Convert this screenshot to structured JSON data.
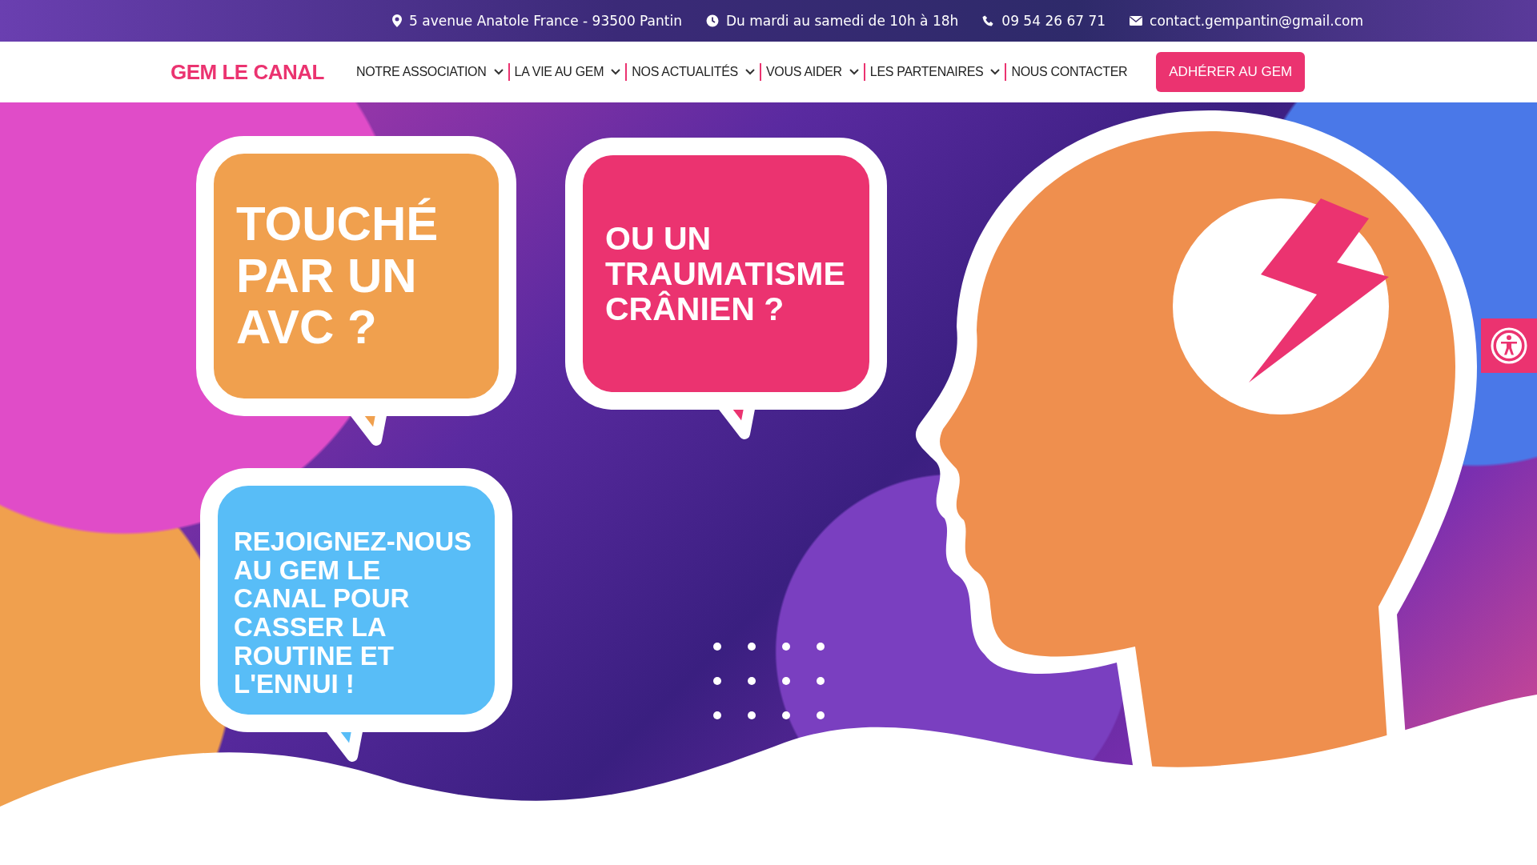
{
  "top_bar": {
    "items": [
      {
        "kind": "address",
        "text": "5 avenue Anatole France - 93500 Pantin"
      },
      {
        "kind": "hours",
        "text": "Du mardi au samedi de 10h à 18h"
      },
      {
        "kind": "phone",
        "text": "09 54 26 67 71"
      },
      {
        "kind": "email",
        "text": "contact.gempantin@gmail.com"
      }
    ]
  },
  "nav": {
    "logo": "GEM LE CANAL",
    "items": [
      {
        "label": "NOTRE ASSOCIATION",
        "dropdown": true
      },
      {
        "label": "LA VIE AU GEM",
        "dropdown": true
      },
      {
        "label": "NOS ACTUALITÉS",
        "dropdown": true
      },
      {
        "label": "VOUS AIDER",
        "dropdown": true
      },
      {
        "label": "LES PARTENAIRES",
        "dropdown": true
      },
      {
        "label": "NOUS CONTACTER",
        "dropdown": false
      }
    ],
    "cta": "ADHÉRER AU GEM"
  },
  "hero": {
    "bubbles": [
      {
        "text": "TOUCHÉ PAR UN AVC ?",
        "color": "#f0a04e"
      },
      {
        "text": "OU UN TRAUMATISME CRÂNIEN ?",
        "color": "#eb3370"
      },
      {
        "text": "REJOIGNEZ-NOUS AU GEM LE CANAL POUR CASSER LA ROUTINE ET L'ENNUI !",
        "color": "#58bdf7"
      }
    ]
  }
}
